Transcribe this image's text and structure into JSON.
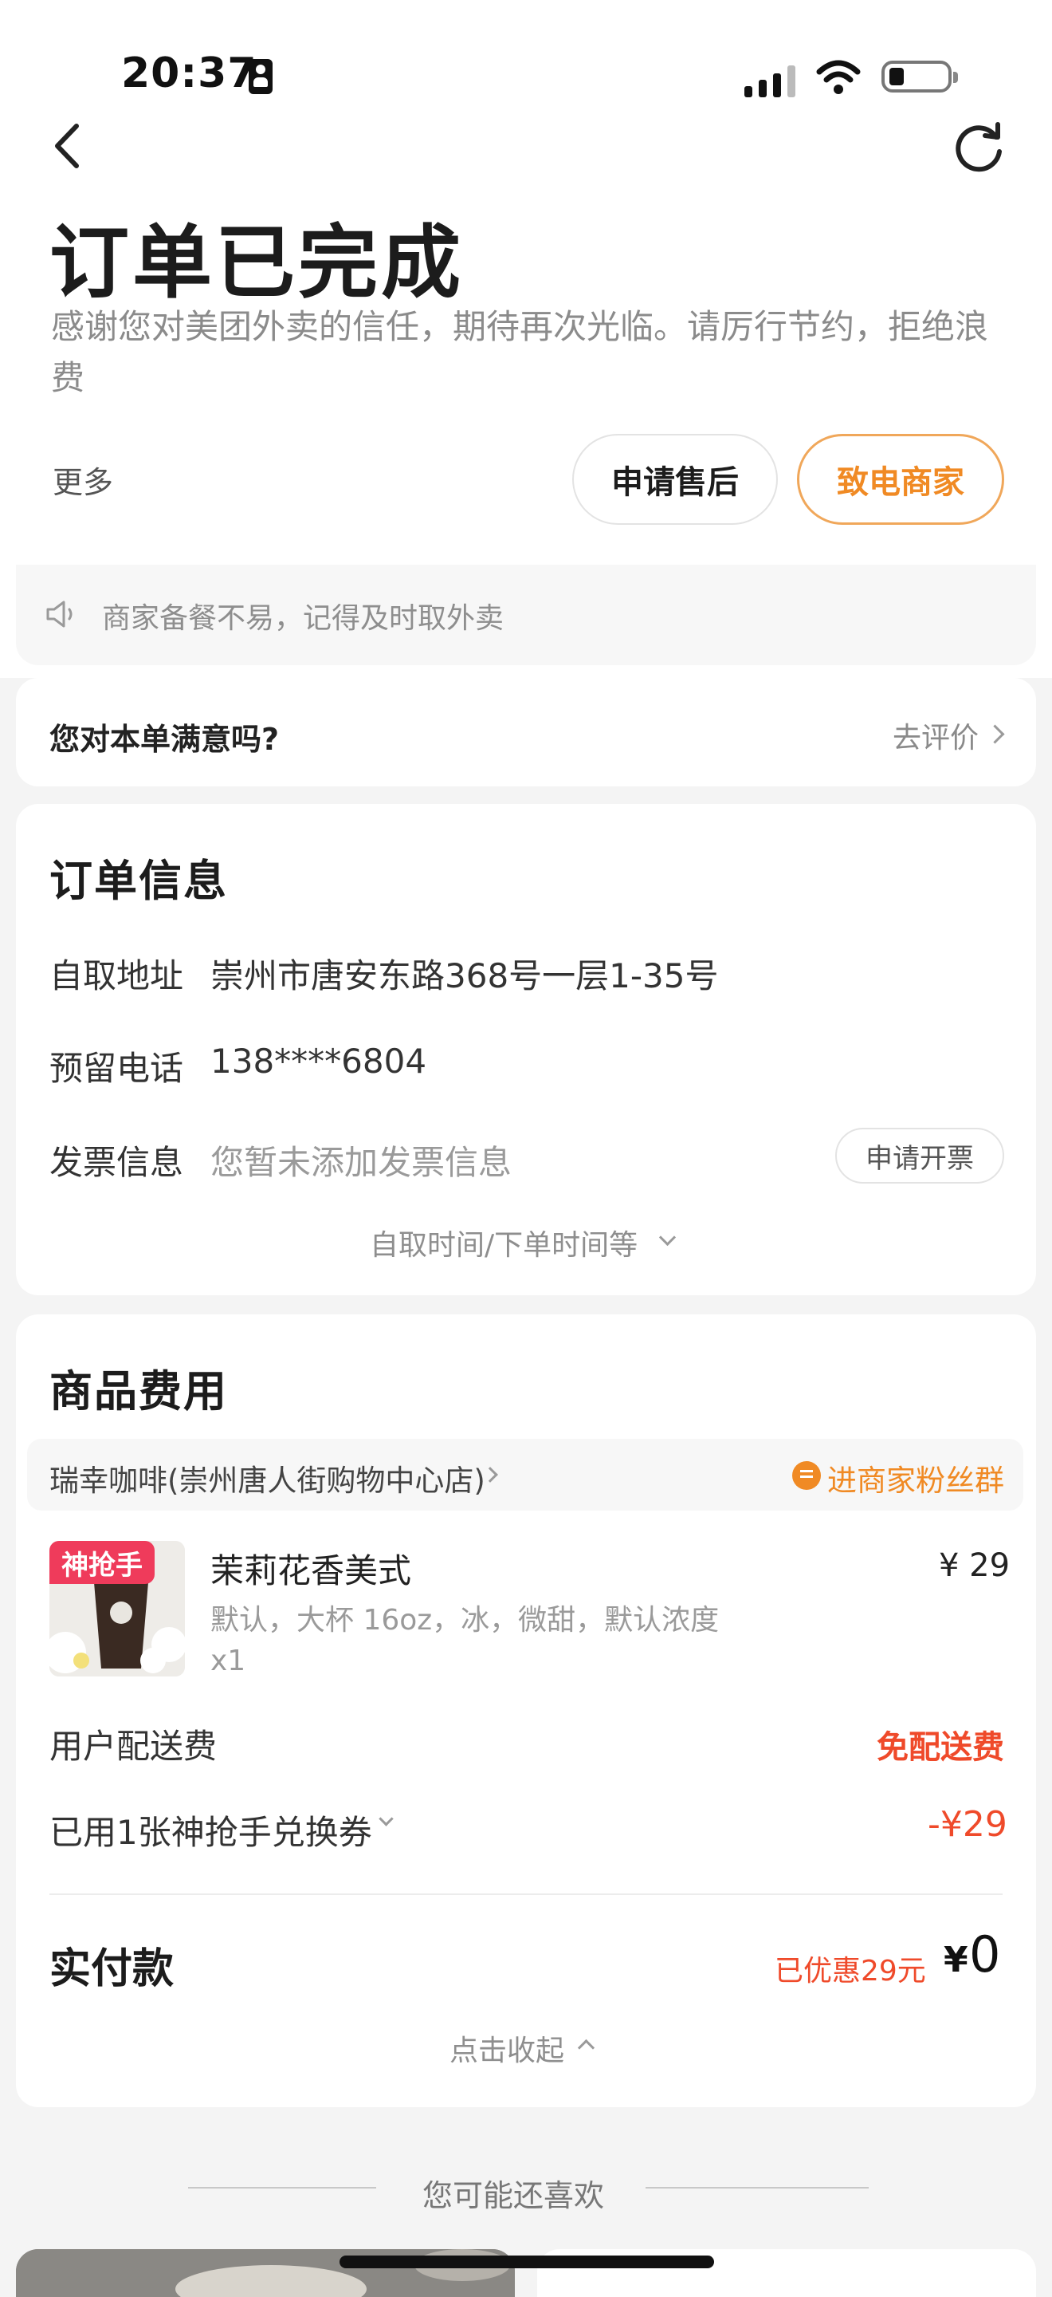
{
  "status_bar": {
    "time": "20:37"
  },
  "header": {
    "title": "订单已完成",
    "subtitle": "感谢您对美团外卖的信任，期待再次光临。请厉行节约，拒绝浪费",
    "more_label": "更多",
    "after_sale_label": "申请售后",
    "call_merchant_label": "致电商家"
  },
  "notice": {
    "text": "商家备餐不易，记得及时取外卖"
  },
  "rating": {
    "question": "您对本单满意吗?",
    "link_label": "去评价"
  },
  "order_info": {
    "title": "订单信息",
    "rows": [
      {
        "label": "自取地址",
        "value": "崇州市唐安东路368号一层1-35号"
      },
      {
        "label": "预留电话",
        "value": "138****6804"
      },
      {
        "label": "发票信息",
        "value": "您暂未添加发票信息"
      }
    ],
    "invoice_button": "申请开票",
    "expand_label": "自取时间/下单时间等"
  },
  "fees": {
    "title": "商品费用",
    "store_name": "瑞幸咖啡(崇州唐人街购物中心店)",
    "fan_group_label": "进商家粉丝群",
    "product": {
      "badge": "神抢手",
      "name": "茉莉花香美式",
      "spec": "默认，大杯 16oz，冰，微甜，默认浓度",
      "qty": "x1",
      "price": "¥ 29"
    },
    "delivery_label": "用户配送费",
    "delivery_value": "免配送费",
    "coupon_label": "已用1张神抢手兑换券",
    "coupon_value": "-¥29",
    "paid_label": "实付款",
    "saved_text": "已优惠29元",
    "currency": "¥",
    "total": "0",
    "collapse_label": "点击收起"
  },
  "recommend": {
    "title": "您可能还喜欢"
  },
  "colors": {
    "accent": "#f08a24",
    "discount_red": "#ef4a2a",
    "badge_pink": "#ef3b5b"
  }
}
